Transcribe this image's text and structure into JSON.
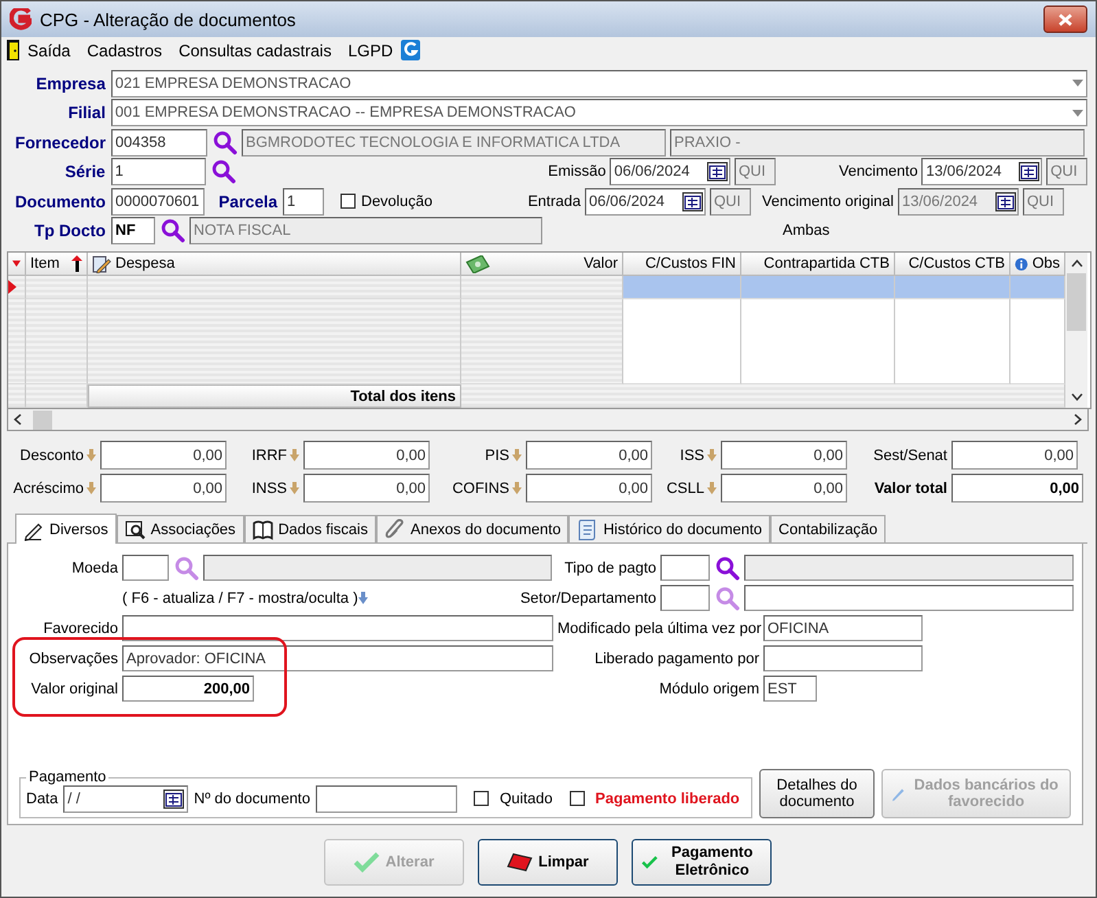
{
  "window": {
    "title": "CPG - Alteração de documentos"
  },
  "menu": [
    {
      "label": "Saída"
    },
    {
      "label": "Cadastros"
    },
    {
      "label": "Consultas cadastrais"
    },
    {
      "label": "LGPD"
    }
  ],
  "header": {
    "empresa": {
      "label": "Empresa",
      "value": "021 EMPRESA DEMONSTRACAO"
    },
    "filial": {
      "label": "Filial",
      "value": "001 EMPRESA DEMONSTRACAO -- EMPRESA DEMONSTRACAO"
    },
    "fornecedor": {
      "label": "Fornecedor",
      "code": "004358",
      "name": "BGMRODOTEC TECNOLOGIA E INFORMATICA LTDA",
      "extra": "PRAXIO -"
    },
    "serie": {
      "label": "Série",
      "value": "1"
    },
    "documento": {
      "label": "Documento",
      "value": "0000070601"
    },
    "parcela": {
      "label": "Parcela",
      "value": "1"
    },
    "devolucao": {
      "label": "Devolução",
      "checked": false
    },
    "tp_docto": {
      "label": "Tp Docto",
      "code": "NF",
      "name": "NOTA FISCAL"
    },
    "emissao": {
      "label": "Emissão",
      "date": "06/06/2024",
      "weekday": "QUI",
      "disabled": false
    },
    "entrada": {
      "label": "Entrada",
      "date": "06/06/2024",
      "weekday": "QUI",
      "disabled": false
    },
    "vencimento": {
      "label": "Vencimento",
      "date": "13/06/2024",
      "weekday": "QUI",
      "disabled": false
    },
    "vencimento_original": {
      "label": "Vencimento original",
      "date": "13/06/2024",
      "weekday": "QUI",
      "disabled": true
    },
    "ambas": "Ambas"
  },
  "grid": {
    "columns": [
      {
        "label": "Item"
      },
      {
        "label": "Despesa"
      },
      {
        "label": "Valor"
      },
      {
        "label": "C/Custos FIN"
      },
      {
        "label": "Contrapartida CTB"
      },
      {
        "label": "C/Custos CTB"
      },
      {
        "label": "Obs"
      }
    ],
    "rows": [
      {
        "selected": true
      }
    ],
    "total_label": "Total dos itens"
  },
  "totals": [
    {
      "label": "Desconto",
      "value": "0,00",
      "kind": "adjust"
    },
    {
      "label": "IRRF",
      "value": "0,00",
      "kind": "adjust"
    },
    {
      "label": "PIS",
      "value": "0,00",
      "kind": "adjust"
    },
    {
      "label": "ISS",
      "value": "0,00",
      "kind": "adjust"
    },
    {
      "label": "Sest/Senat",
      "value": "0,00",
      "kind": "plain"
    },
    {
      "label": "Acréscimo",
      "value": "0,00",
      "kind": "adjust"
    },
    {
      "label": "INSS",
      "value": "0,00",
      "kind": "adjust"
    },
    {
      "label": "COFINS",
      "value": "0,00",
      "kind": "adjust"
    },
    {
      "label": "CSLL",
      "value": "0,00",
      "kind": "adjust"
    },
    {
      "label": "Valor total",
      "value": "0,00",
      "kind": "total"
    }
  ],
  "tabs": [
    {
      "label": "Diversos",
      "selected": true
    },
    {
      "label": "Associações",
      "selected": false
    },
    {
      "label": "Dados fiscais",
      "selected": false
    },
    {
      "label": "Anexos do documento",
      "selected": false
    },
    {
      "label": "Histórico do documento",
      "selected": false
    },
    {
      "label": "Contabilização",
      "selected": false
    }
  ],
  "diversos": {
    "moeda": {
      "label": "Moeda"
    },
    "hint": "( F6 - atualiza / F7 - mostra/oculta )",
    "favorecido": {
      "label": "Favorecido"
    },
    "observacoes": {
      "label": "Observações",
      "value": "Aprovador: OFICINA"
    },
    "valor_original": {
      "label": "Valor original",
      "value": "200,00"
    },
    "tipo_pagto": {
      "label": "Tipo de pagto"
    },
    "setor": {
      "label": "Setor/Departamento"
    },
    "modificado": {
      "label": "Modificado pela última vez por",
      "value": "OFICINA"
    },
    "liberado_por": {
      "label": "Liberado pagamento por"
    },
    "modulo": {
      "label": "Módulo origem",
      "value": "EST"
    }
  },
  "pagamento": {
    "legend": "Pagamento",
    "data_label": "Data",
    "data_value": " /  /",
    "doc_label": "Nº do documento",
    "quitado": {
      "label": "Quitado",
      "checked": false
    },
    "liberado": {
      "label": "Pagamento liberado",
      "checked": false
    }
  },
  "side_buttons": [
    {
      "label": "Detalhes do documento",
      "disabled": false
    },
    {
      "label": "Dados bancários do favorecido",
      "disabled": true
    }
  ],
  "buttons": [
    {
      "label": "Alterar",
      "disabled": true
    },
    {
      "label": "Limpar",
      "disabled": false
    },
    {
      "label": "Pagamento Eletrônico",
      "disabled": false
    }
  ]
}
